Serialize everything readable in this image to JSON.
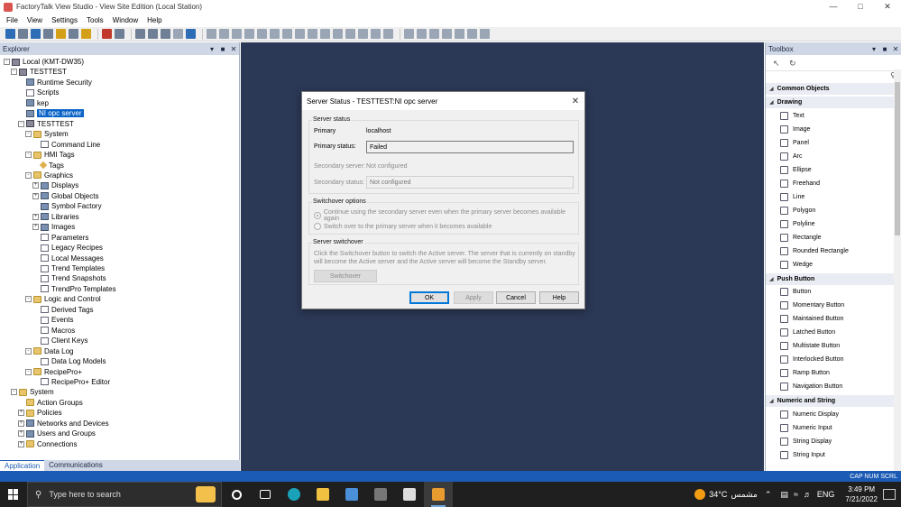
{
  "window": {
    "title": "FactoryTalk View Studio - View Site Edition (Local Station)"
  },
  "menu": [
    "File",
    "View",
    "Settings",
    "Tools",
    "Window",
    "Help"
  ],
  "explorer": {
    "title": "Explorer",
    "tree": [
      {
        "label": "Local (KMT-DW35)",
        "depth": 0,
        "exp": "-",
        "icon": "pc"
      },
      {
        "label": "TESTTEST",
        "depth": 1,
        "exp": "-",
        "icon": "pc"
      },
      {
        "label": "Runtime Security",
        "depth": 2,
        "exp": "",
        "icon": "item"
      },
      {
        "label": "Scripts",
        "depth": 2,
        "exp": "",
        "icon": "doc"
      },
      {
        "label": "kep",
        "depth": 2,
        "exp": "",
        "icon": "item"
      },
      {
        "label": "NI opc server",
        "depth": 2,
        "exp": "",
        "icon": "item",
        "selected": true
      },
      {
        "label": "TESTTEST",
        "depth": 2,
        "exp": "-",
        "icon": "pc"
      },
      {
        "label": "System",
        "depth": 3,
        "exp": "-",
        "icon": "folder"
      },
      {
        "label": "Command Line",
        "depth": 4,
        "exp": "",
        "icon": "doc"
      },
      {
        "label": "HMI Tags",
        "depth": 3,
        "exp": "-",
        "icon": "folder"
      },
      {
        "label": "Tags",
        "depth": 4,
        "exp": "",
        "icon": "tag"
      },
      {
        "label": "Graphics",
        "depth": 3,
        "exp": "-",
        "icon": "folder"
      },
      {
        "label": "Displays",
        "depth": 4,
        "exp": "+",
        "icon": "item"
      },
      {
        "label": "Global Objects",
        "depth": 4,
        "exp": "+",
        "icon": "item"
      },
      {
        "label": "Symbol Factory",
        "depth": 4,
        "exp": "",
        "icon": "item"
      },
      {
        "label": "Libraries",
        "depth": 4,
        "exp": "+",
        "icon": "item"
      },
      {
        "label": "Images",
        "depth": 4,
        "exp": "+",
        "icon": "item"
      },
      {
        "label": "Parameters",
        "depth": 4,
        "exp": "",
        "icon": "doc"
      },
      {
        "label": "Legacy Recipes",
        "depth": 4,
        "exp": "",
        "icon": "doc"
      },
      {
        "label": "Local Messages",
        "depth": 4,
        "exp": "",
        "icon": "doc"
      },
      {
        "label": "Trend Templates",
        "depth": 4,
        "exp": "",
        "icon": "doc"
      },
      {
        "label": "Trend Snapshots",
        "depth": 4,
        "exp": "",
        "icon": "doc"
      },
      {
        "label": "TrendPro Templates",
        "depth": 4,
        "exp": "",
        "icon": "doc"
      },
      {
        "label": "Logic and Control",
        "depth": 3,
        "exp": "-",
        "icon": "folder"
      },
      {
        "label": "Derived Tags",
        "depth": 4,
        "exp": "",
        "icon": "doc"
      },
      {
        "label": "Events",
        "depth": 4,
        "exp": "",
        "icon": "doc"
      },
      {
        "label": "Macros",
        "depth": 4,
        "exp": "",
        "icon": "doc"
      },
      {
        "label": "Client Keys",
        "depth": 4,
        "exp": "",
        "icon": "doc"
      },
      {
        "label": "Data Log",
        "depth": 3,
        "exp": "-",
        "icon": "folder"
      },
      {
        "label": "Data Log Models",
        "depth": 4,
        "exp": "",
        "icon": "doc"
      },
      {
        "label": "RecipePro+",
        "depth": 3,
        "exp": "-",
        "icon": "folder"
      },
      {
        "label": "RecipePro+ Editor",
        "depth": 4,
        "exp": "",
        "icon": "doc"
      },
      {
        "label": "System",
        "depth": 1,
        "exp": "-",
        "icon": "folder"
      },
      {
        "label": "Action Groups",
        "depth": 2,
        "exp": "",
        "icon": "folder"
      },
      {
        "label": "Policies",
        "depth": 2,
        "exp": "+",
        "icon": "folder"
      },
      {
        "label": "Networks and Devices",
        "depth": 2,
        "exp": "+",
        "icon": "item"
      },
      {
        "label": "Users and Groups",
        "depth": 2,
        "exp": "+",
        "icon": "item"
      },
      {
        "label": "Connections",
        "depth": 2,
        "exp": "+",
        "icon": "folder"
      }
    ],
    "tabs": [
      "Application",
      "Communications"
    ]
  },
  "dialog": {
    "title": "Server Status - TESTTEST:NI opc server",
    "server_status_group": "Server status",
    "primary_label": "Primary",
    "primary_value": "localhost",
    "primary_status_label": "Primary status:",
    "primary_status_value": "Failed",
    "secondary_server_label": "Secondary server:",
    "secondary_server_value": "Not configured",
    "secondary_status_label": "Secondary status:",
    "secondary_status_value": "Not configured",
    "switchover_options_group": "Switchover options",
    "option1": "Continue using the secondary server even when the primary server becomes available again",
    "option2": "Switch over to the primary server when it becomes available",
    "server_switchover_group": "Server switchover",
    "switchover_text": "Click the Switchover button to switch the Active server.  The server that is currently on standby will become the Active server and the Active server will become the Standby server.",
    "switchover_button": "Switchover",
    "ok": "OK",
    "apply": "Apply",
    "cancel": "Cancel",
    "help": "Help"
  },
  "toolbox": {
    "title": "Toolbox",
    "categories": [
      {
        "name": "Common Objects",
        "items": []
      },
      {
        "name": "Drawing",
        "items": [
          "Text",
          "Image",
          "Panel",
          "Arc",
          "Ellipse",
          "Freehand",
          "Line",
          "Polygon",
          "Polyline",
          "Rectangle",
          "Rounded Rectangle",
          "Wedge"
        ]
      },
      {
        "name": "Push Button",
        "items": [
          "Button",
          "Momentary Button",
          "Maintained Button",
          "Latched Button",
          "Multistate Button",
          "Interlocked Button",
          "Ramp Button",
          "Navigation Button"
        ]
      },
      {
        "name": "Numeric and String",
        "items": [
          "Numeric Display",
          "Numeric Input",
          "String Display",
          "String Input"
        ]
      }
    ]
  },
  "statusbar": {
    "text": "CAP  NUM  SCRL"
  },
  "taskbar": {
    "search_placeholder": "Type here to search",
    "weather": "34°C",
    "weather_desc": "مشمس",
    "lang": "ENG",
    "time": "3:49 PM",
    "date": "7/21/2022"
  },
  "colors": {
    "workspace": "#2b3856",
    "selection": "#0a64c8",
    "statusbar": "#1c5bb5"
  }
}
